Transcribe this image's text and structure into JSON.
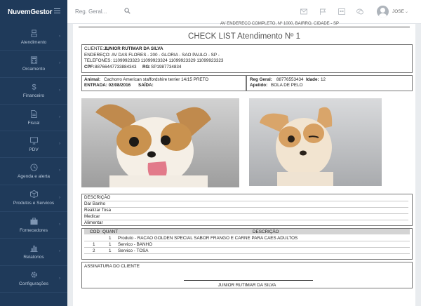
{
  "app": {
    "logo": "NuvemGestor"
  },
  "search": {
    "placeholder": "Reg. Geral..."
  },
  "user": {
    "name": "JOSE"
  },
  "sidebar": {
    "items": [
      {
        "label": "Atendimento",
        "icon": "atendimento-icon"
      },
      {
        "label": "Orcamento",
        "icon": "calculator-icon"
      },
      {
        "label": "Financeiro",
        "icon": "dollar-icon"
      },
      {
        "label": "Fiscal",
        "icon": "document-icon"
      },
      {
        "label": "PDV",
        "icon": "monitor-icon"
      },
      {
        "label": "Agenda e alerta",
        "icon": "clock-icon"
      },
      {
        "label": "Produtos e Servicos",
        "icon": "box-icon"
      },
      {
        "label": "Fornecedores",
        "icon": "briefcase-icon"
      },
      {
        "label": "Relatorios",
        "icon": "bar-chart-icon"
      },
      {
        "label": "Configurações",
        "icon": "gear-icon"
      }
    ]
  },
  "doc": {
    "cut_text": "AV ENDERECO COMPLETO, Nº 1000, BAIRRO, CIDADE - SP",
    "title": "CHECK LIST Atendimento Nº 1",
    "client": {
      "label": "CLIENTE: 1,",
      "name": "JUNIOR RUTIMAR DA SILVA",
      "address": "ENDEREÇO: AV DAS FLORES - 200 - GLORIA - SAO PAULO - SP -",
      "phones": "TELEFONES: 11099923323  11099923324  11099923329  11099923323",
      "cpf_label": "CPF:",
      "cpf": "88766447733884343",
      "rg_label": "RG:",
      "rg": "SP1987734834"
    },
    "animal": {
      "animal_label": "Animal:",
      "animal": "Cachorro  American staffordshire terrier  14/15 PRETO",
      "entrada": "ENTRADA:  02/08/2016",
      "saida": "SAÍDA:",
      "reg_label": "Reg Geral:",
      "reg": "88776553434",
      "idade_label": "Idade:",
      "idade": "12",
      "apelido_label": "Apelido:",
      "apelido": "BOLA DE PELO"
    },
    "descricao": {
      "header": "DESCRIÇÃO",
      "lines": [
        "Dar Banho",
        "Realizar Tosa",
        "Medicar",
        "Alimentar"
      ]
    },
    "items_table": {
      "headers": [
        "COD",
        "QUANT",
        "DESCRIÇÃO"
      ],
      "rows": [
        {
          "cod": "",
          "quant": "1",
          "desc": "Produto - RACAO GOLDEN SPECIAL SABOR FRANGO E CARNE PARA CAES ADULTOS"
        },
        {
          "cod": "1",
          "quant": "1",
          "desc": "Servico - BANHO"
        },
        {
          "cod": "2",
          "quant": "1",
          "desc": "Servico - TOSA"
        }
      ]
    },
    "signature": {
      "label": "ASSINATURA DO CLIENTE",
      "name": "JUNIOR RUTIMAR DA SILVA"
    }
  }
}
